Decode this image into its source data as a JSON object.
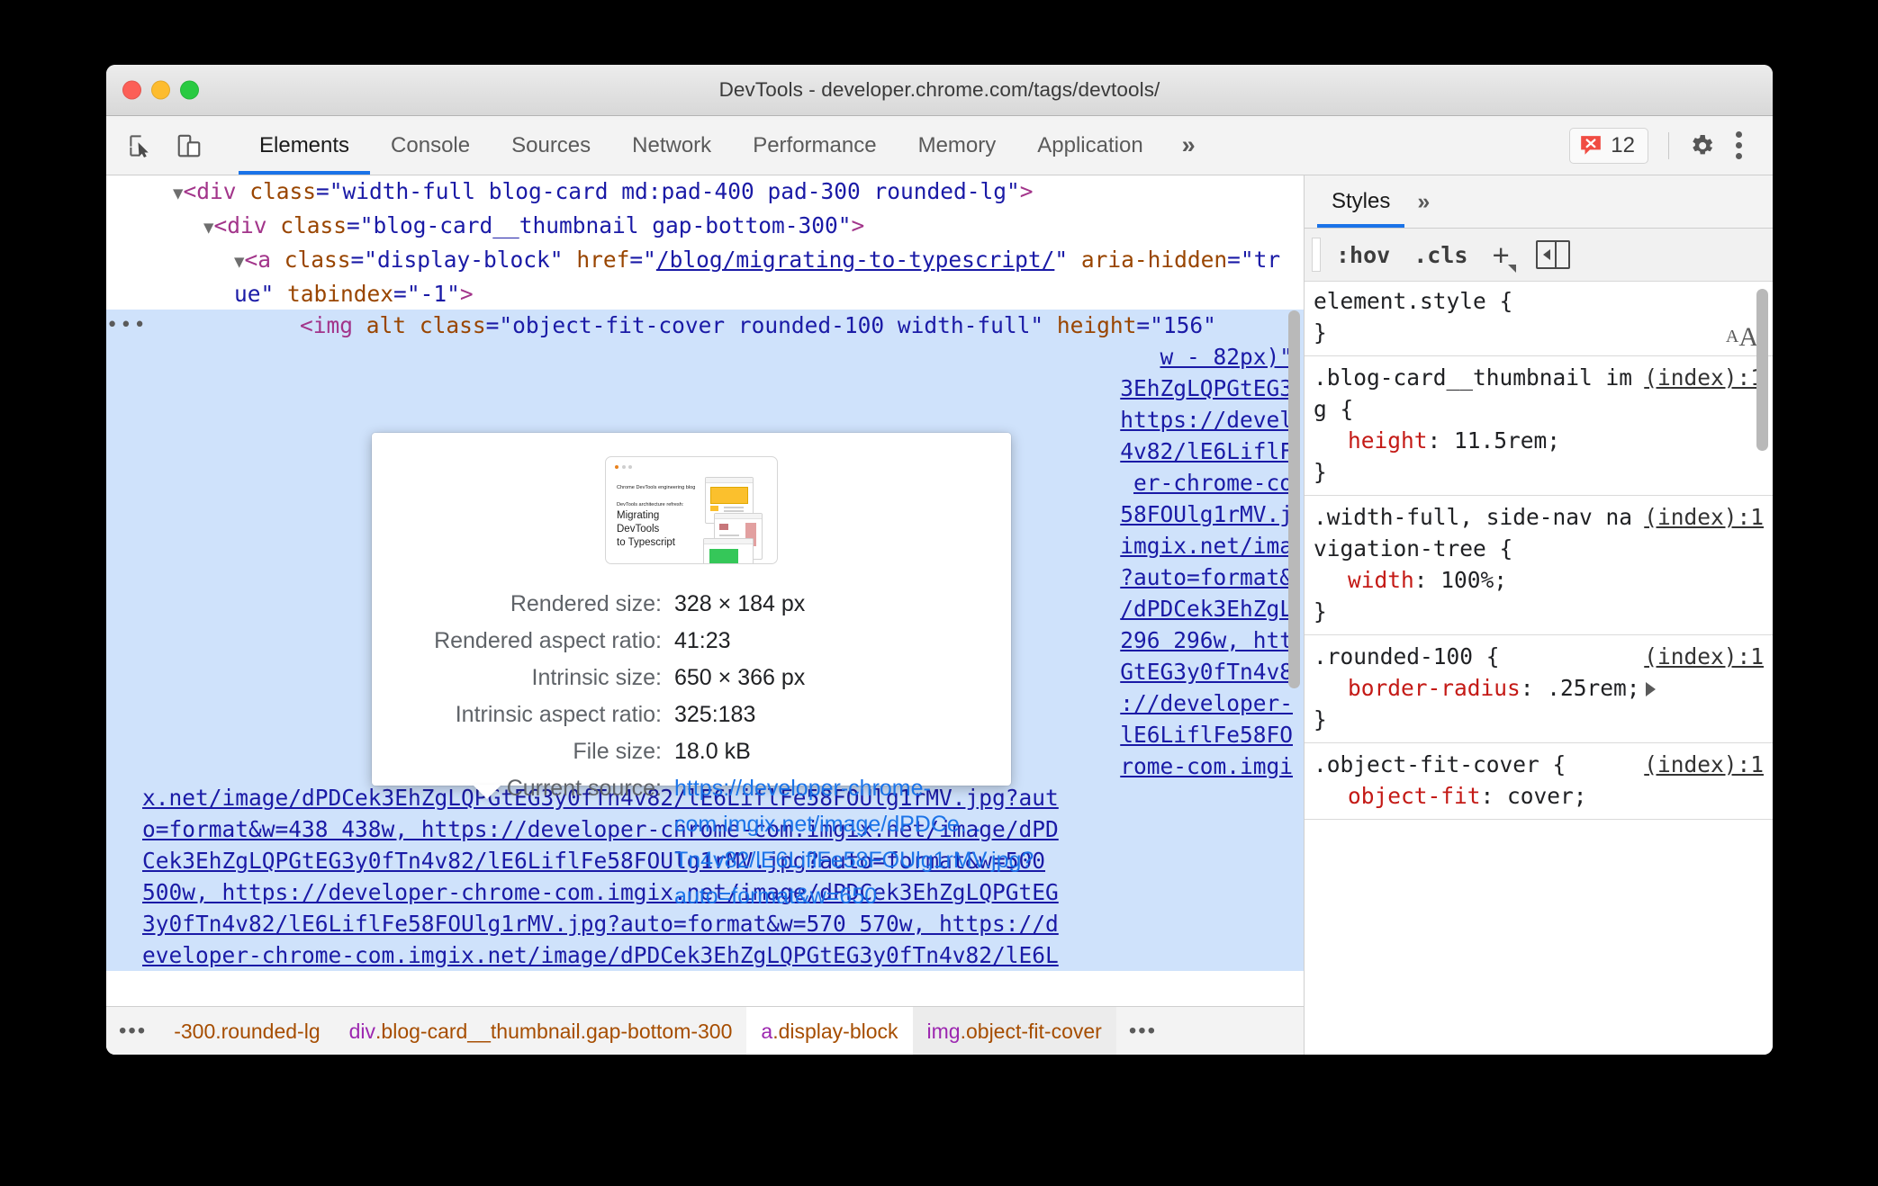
{
  "window": {
    "title": "DevTools - developer.chrome.com/tags/devtools/",
    "traffic_lights": [
      "close",
      "minimize",
      "zoom"
    ]
  },
  "toolbar": {
    "inspect_icon": "inspect-element-icon",
    "device_icon": "device-toolbar-icon",
    "tabs": [
      {
        "label": "Elements",
        "active": true
      },
      {
        "label": "Console",
        "active": false
      },
      {
        "label": "Sources",
        "active": false
      },
      {
        "label": "Network",
        "active": false
      },
      {
        "label": "Performance",
        "active": false
      },
      {
        "label": "Memory",
        "active": false
      },
      {
        "label": "Application",
        "active": false
      }
    ],
    "more_tabs": "»",
    "error_count": "12",
    "error_icon": "error-badge-icon",
    "settings_icon": "gear-icon",
    "menu_icon": "kebab-menu-icon"
  },
  "dom_tree": {
    "lines": [
      {
        "id": "div-blog-card",
        "indent": 1,
        "triangle": true,
        "selected": false,
        "parts": [
          {
            "t": "<",
            "c": "tagp"
          },
          {
            "t": "div",
            "c": "tag"
          },
          {
            "t": " ",
            "c": "plain"
          },
          {
            "t": "class",
            "c": "attr"
          },
          {
            "t": "=",
            "c": "punc"
          },
          {
            "t": "\"width-full blog-card md:pad-400 pad-300 rounded-lg\"",
            "c": "val"
          },
          {
            "t": ">",
            "c": "tagp"
          }
        ]
      },
      {
        "id": "div-thumbnail",
        "indent": 2,
        "triangle": true,
        "selected": false,
        "parts": [
          {
            "t": "<",
            "c": "tagp"
          },
          {
            "t": "div",
            "c": "tag"
          },
          {
            "t": " ",
            "c": "plain"
          },
          {
            "t": "class",
            "c": "attr"
          },
          {
            "t": "=",
            "c": "punc"
          },
          {
            "t": "\"blog-card__thumbnail gap-bottom-300\"",
            "c": "val"
          },
          {
            "t": ">",
            "c": "tagp"
          }
        ]
      },
      {
        "id": "a-display-block",
        "indent": 3,
        "triangle": true,
        "selected": false,
        "parts": [
          {
            "t": "<",
            "c": "tagp"
          },
          {
            "t": "a",
            "c": "tag"
          },
          {
            "t": " ",
            "c": "plain"
          },
          {
            "t": "class",
            "c": "attr"
          },
          {
            "t": "=",
            "c": "punc"
          },
          {
            "t": "\"display-block\"",
            "c": "val"
          },
          {
            "t": " ",
            "c": "plain"
          },
          {
            "t": "href",
            "c": "attr"
          },
          {
            "t": "=\"",
            "c": "punc"
          },
          {
            "t": "/blog/migrating-to-typescript/",
            "c": "link"
          },
          {
            "t": "\" ",
            "c": "punc"
          },
          {
            "t": "aria-hidden",
            "c": "attr"
          },
          {
            "t": "=",
            "c": "punc"
          },
          {
            "t": "\"true\"",
            "c": "val"
          },
          {
            "t": " ",
            "c": "plain"
          },
          {
            "t": "tabindex",
            "c": "attr"
          },
          {
            "t": "=",
            "c": "punc"
          },
          {
            "t": "\"-1\"",
            "c": "val"
          },
          {
            "t": ">",
            "c": "tagp"
          }
        ]
      }
    ],
    "selected_line": {
      "gutter_ellipsis": "•••",
      "prefix_parts": [
        {
          "t": "<",
          "c": "tagp"
        },
        {
          "t": "img",
          "c": "tag"
        },
        {
          "t": " ",
          "c": "plain"
        },
        {
          "t": "alt",
          "c": "attr"
        },
        {
          "t": " ",
          "c": "plain"
        },
        {
          "t": "class",
          "c": "attr"
        },
        {
          "t": "=",
          "c": "punc"
        },
        {
          "t": "\"object-fit-cover rounded-100 width-full\"",
          "c": "val"
        },
        {
          "t": " ",
          "c": "plain"
        },
        {
          "t": "height",
          "c": "attr"
        },
        {
          "t": "=",
          "c": "punc"
        },
        {
          "t": "\"156\"",
          "c": "val"
        }
      ],
      "occluded_fragments": [
        "w - 82px)\"",
        "3EhZgLQPGtEG3",
        "https://devel",
        "4v82/lE6LiflF",
        "er-chrome-co",
        "58FOUlg1rMV.j",
        "imgix.net/ima",
        "?auto=format&",
        "/dPDCek3EhZgL",
        "296 296w, htt",
        "GtEG3y0fTn4v8",
        "://developer-",
        "lE6LiflFe58FO",
        "rome-com.imgi"
      ],
      "tail_lines": [
        "x.net/image/dPDCek3EhZgLQPGtEG3y0fTn4v82/lE6LiflFe58FOUlg1rMV.jpg?aut",
        "o=format&w=438 438w, https://developer-chrome-com.imgix.net/image/dPD",
        "Cek3EhZgLQPGtEG3y0fTn4v82/lE6LiflFe58FOUlg1rMV.jpg?auto=format&w=500",
        "500w, https://developer-chrome-com.imgix.net/image/dPDCek3EhZgLQPGtEG",
        "3y0fTn4v82/lE6LiflFe58FOUlg1rMV.jpg?auto=format&w=570 570w, https://d",
        "eveloper-chrome-com.imgix.net/image/dPDCek3EhZgLQPGtEG3y0fTn4v82/lE6L"
      ]
    }
  },
  "tooltip": {
    "preview": {
      "eyebrow": "Chrome DevTools engineering blog",
      "kicker": "DevTools architecture refresh:",
      "title_line1": "Migrating DevTools",
      "title_line2": "to Typescript"
    },
    "rows": [
      {
        "label": "Rendered size:",
        "value": "328 × 184 px",
        "is_link": false
      },
      {
        "label": "Rendered aspect ratio:",
        "value": "41:23",
        "is_link": false
      },
      {
        "label": "Intrinsic size:",
        "value": "650 × 366 px",
        "is_link": false
      },
      {
        "label": "Intrinsic aspect ratio:",
        "value": "325:183",
        "is_link": false
      },
      {
        "label": "File size:",
        "value": "18.0 kB",
        "is_link": false
      },
      {
        "label": "Current source:",
        "value": "https://developer-chrome-com.imgix.net/image/dPDCe…Tn4v82/lE6LiflFe58FOUlg1rMV.jpg?auto=format&w=650",
        "is_link": true
      }
    ]
  },
  "breadcrumb": {
    "overflow_ellipsis": "•••",
    "items": [
      {
        "prefix": "",
        "text": "-300.rounded-lg",
        "state": "partial"
      },
      {
        "prefix": "div",
        "text": ".blog-card__thumbnail.gap-bottom-300",
        "state": "normal"
      },
      {
        "prefix": "a",
        "text": ".display-block",
        "state": "white"
      },
      {
        "prefix": "img",
        "text": ".object-fit-cover",
        "state": "last"
      }
    ],
    "trailing_ellipsis": "•••"
  },
  "styles_pane": {
    "tabs": [
      {
        "label": "Styles",
        "active": true
      }
    ],
    "more_tabs": "»",
    "toolbar": {
      "hov": ":hov",
      "cls": ".cls",
      "new_rule": "+",
      "toggle_panel_icon": "toggle-sidebar-icon",
      "computed_font_icon": "font-editor-icon"
    },
    "rules": [
      {
        "selector": "element.style {",
        "origin": "",
        "declarations": [],
        "close": "}"
      },
      {
        "selector": ".blog-card__thumbnail img {",
        "origin": "(index):1",
        "declarations": [
          {
            "prop": "height",
            "value": "11.5rem;",
            "expandable": false
          }
        ],
        "close": "}"
      },
      {
        "selector": ".width-full, side-nav navigation-tree {",
        "origin": "(index):1",
        "declarations": [
          {
            "prop": "width",
            "value": "100%;",
            "expandable": false
          }
        ],
        "close": "}"
      },
      {
        "selector": ".rounded-100 {",
        "origin": "(index):1",
        "declarations": [
          {
            "prop": "border-radius",
            "value": ".25rem;",
            "expandable": true
          }
        ],
        "close": "}"
      },
      {
        "selector": ".object-fit-cover {",
        "origin": "(index):1",
        "declarations": [
          {
            "prop": "object-fit",
            "value": "cover;",
            "expandable": false
          }
        ],
        "close": ""
      }
    ]
  },
  "colors": {
    "accent": "#1a73e8",
    "selection": "#cfe2fb",
    "error_red": "#f04c43",
    "tag": "#a2348a",
    "attr": "#994500",
    "value": "#1a1aa6",
    "prop": "#c41a16"
  }
}
